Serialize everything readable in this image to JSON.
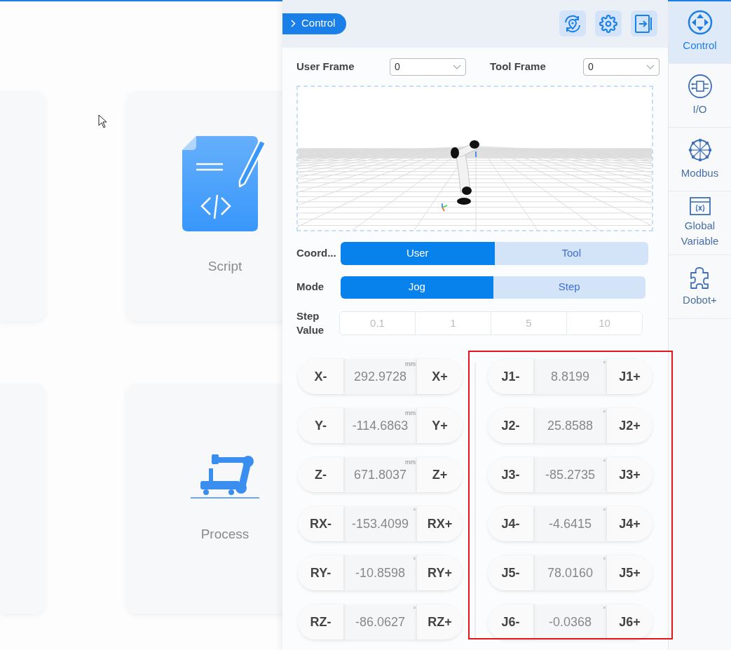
{
  "cards": [
    {
      "label": "Script",
      "kind": "script"
    },
    {
      "label": "Process",
      "kind": "process"
    }
  ],
  "panel": {
    "title": "Control"
  },
  "frames": [
    {
      "label": "User Frame",
      "value": "0"
    },
    {
      "label": "Tool Frame",
      "value": "0"
    }
  ],
  "coord": {
    "label": "Coord...",
    "options": [
      {
        "label": "User",
        "selected": true
      },
      {
        "label": "Tool",
        "selected": false
      }
    ]
  },
  "mode": {
    "label": "Mode",
    "options": [
      {
        "label": "Jog",
        "selected": true
      },
      {
        "label": "Step",
        "selected": false
      }
    ]
  },
  "step_value": {
    "label": "Step Value",
    "options": [
      {
        "label": "0.1",
        "selected": false
      },
      {
        "label": "1",
        "selected": false
      },
      {
        "label": "5",
        "selected": false
      },
      {
        "label": "10",
        "selected": false
      }
    ]
  },
  "cartesian": [
    {
      "minus": "X-",
      "value": "292.9728",
      "unit": "mm",
      "plus": "X+"
    },
    {
      "minus": "Y-",
      "value": "-114.6863",
      "unit": "mm",
      "plus": "Y+"
    },
    {
      "minus": "Z-",
      "value": "671.8037",
      "unit": "mm",
      "plus": "Z+"
    },
    {
      "minus": "RX-",
      "value": "-153.4099",
      "unit": "°",
      "plus": "RX+"
    },
    {
      "minus": "RY-",
      "value": "-10.8598",
      "unit": "°",
      "plus": "RY+"
    },
    {
      "minus": "RZ-",
      "value": "-86.0627",
      "unit": "°",
      "plus": "RZ+"
    }
  ],
  "joints": [
    {
      "minus": "J1-",
      "value": "8.8199",
      "unit": "°",
      "plus": "J1+"
    },
    {
      "minus": "J2-",
      "value": "25.8588",
      "unit": "°",
      "plus": "J2+"
    },
    {
      "minus": "J3-",
      "value": "-85.2735",
      "unit": "°",
      "plus": "J3+"
    },
    {
      "minus": "J4-",
      "value": "-4.6415",
      "unit": "°",
      "plus": "J4+"
    },
    {
      "minus": "J5-",
      "value": "78.0160",
      "unit": "°",
      "plus": "J5+"
    },
    {
      "minus": "J6-",
      "value": "-0.0368",
      "unit": "°",
      "plus": "J6+"
    }
  ],
  "sidebar": {
    "items": [
      {
        "label": "Control",
        "kind": "control",
        "selected": true
      },
      {
        "label": "I/O",
        "kind": "io",
        "selected": false
      },
      {
        "label": "Modbus",
        "kind": "modbus",
        "selected": false
      },
      {
        "label": "Global Variable",
        "kind": "variable",
        "selected": false
      },
      {
        "label": "Dobot+",
        "kind": "plugin",
        "selected": false
      }
    ]
  }
}
